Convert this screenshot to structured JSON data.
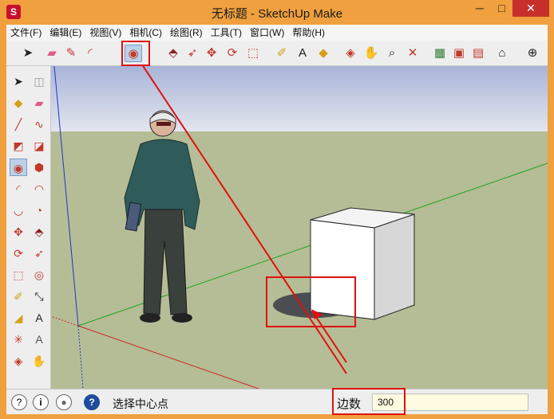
{
  "window": {
    "title": "无标题 - SketchUp Make",
    "app_icon_glyph": "S",
    "minimize_glyph": "─",
    "maximize_glyph": "□",
    "close_glyph": "✕"
  },
  "menubar": {
    "items": [
      "文件(F)",
      "编辑(E)",
      "视图(V)",
      "相机(C)",
      "绘图(R)",
      "工具(T)",
      "窗口(W)",
      "帮助(H)"
    ]
  },
  "toolbar": {
    "icons": [
      {
        "name": "select-icon",
        "glyph": "➤",
        "color": "#222"
      },
      {
        "name": "eraser-icon",
        "glyph": "▰",
        "color": "#e05a8a"
      },
      {
        "name": "pencil-icon",
        "glyph": "✎",
        "color": "#c0392b"
      },
      {
        "name": "arc-icon",
        "glyph": "◜",
        "color": "#c0392b"
      },
      {
        "name": "circle-icon",
        "glyph": "◉",
        "color": "#c0392b"
      },
      {
        "name": "push-pull-icon",
        "glyph": "⬘",
        "color": "#8b1e1e"
      },
      {
        "name": "follow-me-icon",
        "glyph": "➶",
        "color": "#c0392b"
      },
      {
        "name": "move-icon",
        "glyph": "✥",
        "color": "#c0392b"
      },
      {
        "name": "rotate-icon",
        "glyph": "⟳",
        "color": "#c0392b"
      },
      {
        "name": "scale-icon",
        "glyph": "⬚",
        "color": "#c0392b"
      },
      {
        "name": "tape-measure-icon",
        "glyph": "✐",
        "color": "#d4a017"
      },
      {
        "name": "text-icon",
        "glyph": "A",
        "color": "#222"
      },
      {
        "name": "paint-bucket-icon",
        "glyph": "◆",
        "color": "#d4a017"
      },
      {
        "name": "orbit-icon",
        "glyph": "◈",
        "color": "#c0392b"
      },
      {
        "name": "pan-icon",
        "glyph": "✋",
        "color": "#555"
      },
      {
        "name": "zoom-icon",
        "glyph": "⌕",
        "color": "#222"
      },
      {
        "name": "zoom-extents-icon",
        "glyph": "✕",
        "color": "#c0392b"
      },
      {
        "name": "add-location-icon",
        "glyph": "▦",
        "color": "#2e7d32"
      },
      {
        "name": "components-icon",
        "glyph": "▣",
        "color": "#c0392b"
      },
      {
        "name": "warehouse-icon",
        "glyph": "▤",
        "color": "#c0392b"
      },
      {
        "name": "house-icon",
        "glyph": "⌂",
        "color": "#222"
      },
      {
        "name": "crosshair-icon",
        "glyph": "⊕",
        "color": "#222"
      }
    ]
  },
  "sidebar": {
    "icons": [
      {
        "name": "select-icon",
        "glyph": "➤",
        "color": "#222"
      },
      {
        "name": "make-component-icon",
        "glyph": "◫",
        "color": "#999"
      },
      {
        "name": "paint-bucket-icon",
        "glyph": "◆",
        "color": "#d4a017"
      },
      {
        "name": "eraser-icon",
        "glyph": "▰",
        "color": "#e05a8a"
      },
      {
        "name": "line-icon",
        "glyph": "╱",
        "color": "#c0392b"
      },
      {
        "name": "freehand-icon",
        "glyph": "∿",
        "color": "#c0392b"
      },
      {
        "name": "rectangle-icon",
        "glyph": "◩",
        "color": "#c0392b"
      },
      {
        "name": "rotated-rectangle-icon",
        "glyph": "◪",
        "color": "#c0392b"
      },
      {
        "name": "circle-icon",
        "glyph": "◉",
        "color": "#c0392b"
      },
      {
        "name": "polygon-icon",
        "glyph": "⬢",
        "color": "#c0392b"
      },
      {
        "name": "arc-icon",
        "glyph": "◜",
        "color": "#c0392b"
      },
      {
        "name": "two-point-arc-icon",
        "glyph": "◠",
        "color": "#c0392b"
      },
      {
        "name": "three-point-arc-icon",
        "glyph": "◡",
        "color": "#c0392b"
      },
      {
        "name": "pie-icon",
        "glyph": "◔",
        "color": "#c0392b"
      },
      {
        "name": "move-icon",
        "glyph": "✥",
        "color": "#c0392b"
      },
      {
        "name": "push-pull-icon",
        "glyph": "⬘",
        "color": "#8b1e1e"
      },
      {
        "name": "rotate-icon",
        "glyph": "⟳",
        "color": "#c0392b"
      },
      {
        "name": "follow-me-icon",
        "glyph": "➶",
        "color": "#c0392b"
      },
      {
        "name": "scale-icon",
        "glyph": "⬚",
        "color": "#c0392b"
      },
      {
        "name": "offset-icon",
        "glyph": "◎",
        "color": "#c0392b"
      },
      {
        "name": "tape-measure-icon",
        "glyph": "✐",
        "color": "#d4a017"
      },
      {
        "name": "dimension-icon",
        "glyph": "⤡",
        "color": "#222"
      },
      {
        "name": "protractor-icon",
        "glyph": "◢",
        "color": "#d4a017"
      },
      {
        "name": "text-icon",
        "glyph": "A",
        "color": "#222"
      },
      {
        "name": "axes-icon",
        "glyph": "✳",
        "color": "#c0392b"
      },
      {
        "name": "3d-text-icon",
        "glyph": "A",
        "color": "#555"
      },
      {
        "name": "orbit-icon",
        "glyph": "◈",
        "color": "#c0392b"
      },
      {
        "name": "pan-icon",
        "glyph": "✋",
        "color": "#555"
      }
    ]
  },
  "statusbar": {
    "geolocation_icon": "?",
    "credits_icon": "i",
    "user_icon": "●",
    "help_icon": "?",
    "status_text": "选择中心点",
    "vcb_label": "边数",
    "vcb_value": "300"
  },
  "colors": {
    "sky_top": "#a8b4d8",
    "sky_bottom": "#dfe3ee",
    "ground": "#b5bd96",
    "annotation_red": "#e01010"
  }
}
